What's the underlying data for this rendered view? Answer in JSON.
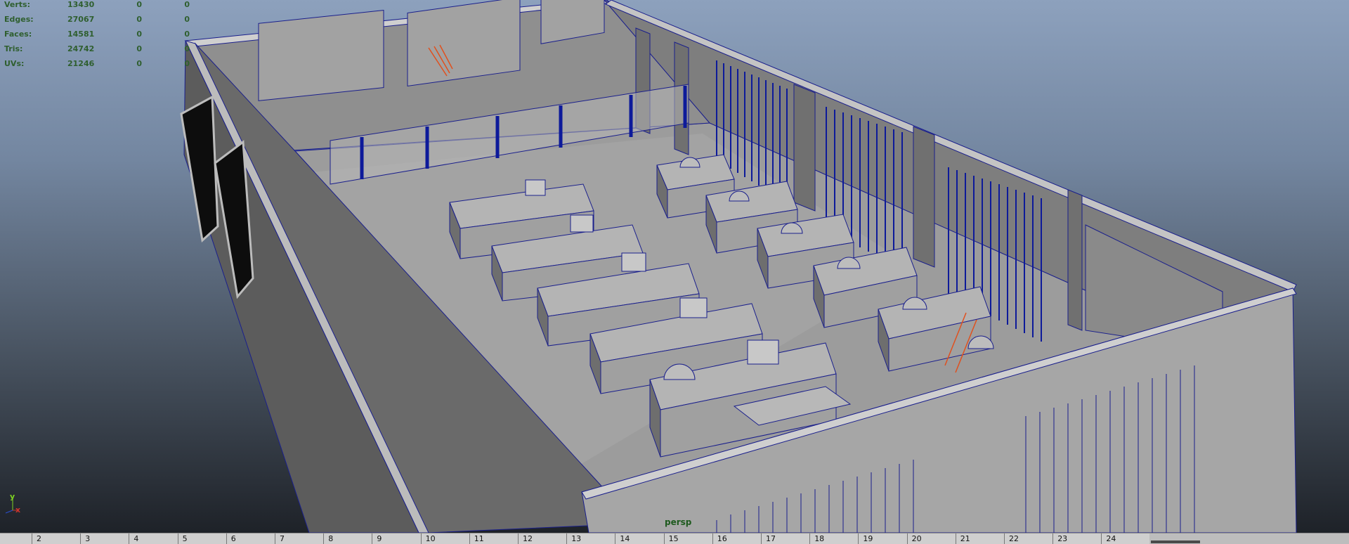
{
  "hud": {
    "rows": [
      {
        "label": "Verts:",
        "v1": "13430",
        "v2": "0",
        "v3": "0"
      },
      {
        "label": "Edges:",
        "v1": "27067",
        "v2": "0",
        "v3": "0"
      },
      {
        "label": "Faces:",
        "v1": "14581",
        "v2": "0",
        "v3": "0"
      },
      {
        "label": "Tris:",
        "v1": "24742",
        "v2": "0",
        "v3": "0"
      },
      {
        "label": "UVs:",
        "v1": "21246",
        "v2": "0",
        "v3": "0"
      }
    ]
  },
  "viewport": {
    "camera": "persp"
  },
  "axis": {
    "y": "y",
    "x": "x"
  },
  "timeline": {
    "frames": [
      "2",
      "3",
      "4",
      "5",
      "6",
      "7",
      "8",
      "9",
      "10",
      "11",
      "12",
      "13",
      "14",
      "15",
      "16",
      "17",
      "18",
      "19",
      "20",
      "21",
      "22",
      "23",
      "24"
    ]
  },
  "colors": {
    "wireframe": "#0d1a9a",
    "highlight": "#e0501e",
    "hud_text": "#2f5f2f"
  }
}
